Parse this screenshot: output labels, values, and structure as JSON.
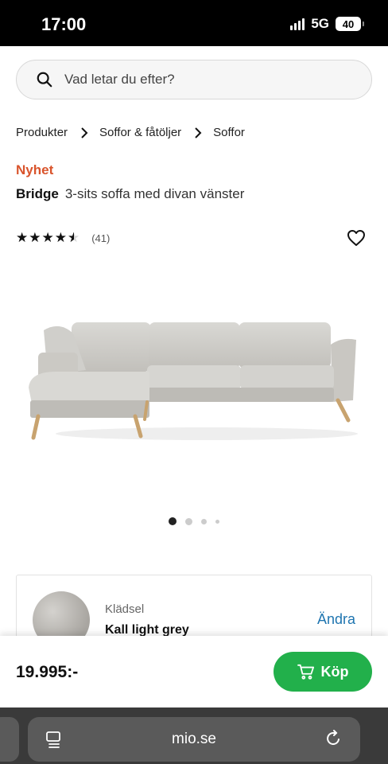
{
  "status_bar": {
    "time": "17:00",
    "network": "5G",
    "battery": "40"
  },
  "search": {
    "placeholder": "Vad letar du efter?",
    "icon": "search-icon"
  },
  "breadcrumb": [
    "Produkter",
    "Soffor & fåtöljer",
    "Soffor"
  ],
  "product": {
    "badge": "Nyhet",
    "name": "Bridge",
    "description": "3-sits soffa med divan vänster",
    "rating": 4.5,
    "rating_max": 5,
    "review_count": "(41)"
  },
  "gallery": {
    "image_count": 4,
    "active_index": 0
  },
  "option": {
    "label": "Klädsel",
    "value": "Kall light grey",
    "change_label": "Ändra"
  },
  "purchase": {
    "price": "19.995:-",
    "buy_label": "Köp",
    "button_color": "#22b04b"
  },
  "browser": {
    "url": "mio.se"
  },
  "colors": {
    "accent_new": "#d9542c",
    "link": "#1f75b0"
  }
}
